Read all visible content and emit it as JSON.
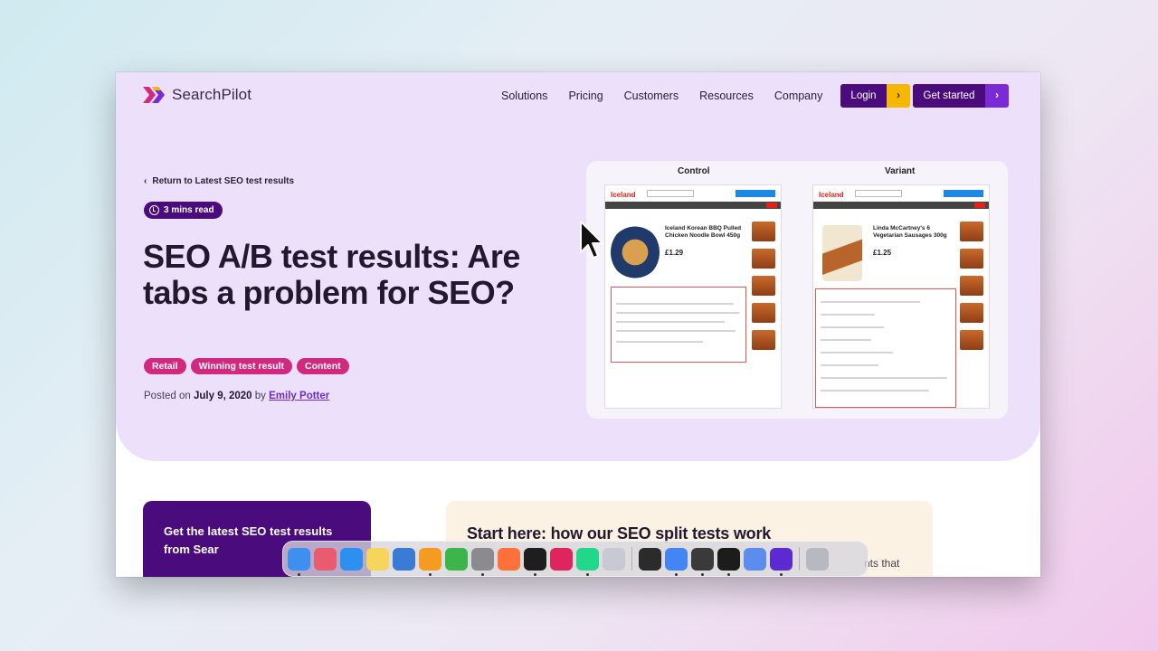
{
  "nav": {
    "logo_text": "SearchPilot",
    "links": [
      "Solutions",
      "Pricing",
      "Customers",
      "Resources",
      "Company"
    ],
    "login_label": "Login",
    "get_started_label": "Get started"
  },
  "hero": {
    "back_link": "Return to Latest SEO test results",
    "read_time": "3 mins read",
    "title": "SEO A/B test results: Are tabs a problem for SEO?",
    "tags": [
      "Retail",
      "Winning test result",
      "Content"
    ],
    "posted_prefix": "Posted on",
    "posted_date": "July 9, 2020",
    "posted_by": "by",
    "author": "Emily Potter"
  },
  "comparison": {
    "control_label": "Control",
    "variant_label": "Variant",
    "control_brand": "Iceland",
    "variant_brand": "Iceland",
    "control_product": "Iceland Korean BBQ Pulled Chicken Noodle Bowl 450g",
    "variant_product": "Linda McCartney's 6 Vegetarian Sausages 300g",
    "control_price": "£1.29",
    "variant_price": "£1.25"
  },
  "lower": {
    "newsletter_text": "Get the latest SEO test results from Sear",
    "start_here_title": "Start here: how our SEO split tests work",
    "start_here_fragment": "nts that"
  },
  "dock": {
    "icons": [
      {
        "name": "finder-icon",
        "color": "#3f8ff0"
      },
      {
        "name": "launchpad-icon",
        "color": "#e95c6f"
      },
      {
        "name": "safari-icon",
        "color": "#2d8ff0"
      },
      {
        "name": "notes-icon",
        "color": "#f6d55c"
      },
      {
        "name": "freeform-icon",
        "color": "#3a7bd5"
      },
      {
        "name": "pages-icon",
        "color": "#f59b22"
      },
      {
        "name": "numbers-icon",
        "color": "#3cb64a"
      },
      {
        "name": "settings-icon",
        "color": "#8a8a8f"
      },
      {
        "name": "firefox-icon",
        "color": "#ff7139"
      },
      {
        "name": "figma-icon",
        "color": "#1e1e1e"
      },
      {
        "name": "scrobbles-icon",
        "color": "#e0245e"
      },
      {
        "name": "pycharm-icon",
        "color": "#21d789"
      },
      {
        "name": "craft-icon",
        "color": "#c9c9d4"
      },
      {
        "name": "bear-icon",
        "color": "#2b2b2b"
      },
      {
        "name": "chrome-icon",
        "color": "#4285f4"
      },
      {
        "name": "mela-icon",
        "color": "#3a3a3a"
      },
      {
        "name": "activity-monitor-icon",
        "color": "#1c1c1c"
      },
      {
        "name": "arc-icon",
        "color": "#5a8dee"
      },
      {
        "name": "linear-icon",
        "color": "#5b2bd1"
      },
      {
        "name": "trash-icon",
        "color": "#b8b8c0"
      }
    ]
  }
}
